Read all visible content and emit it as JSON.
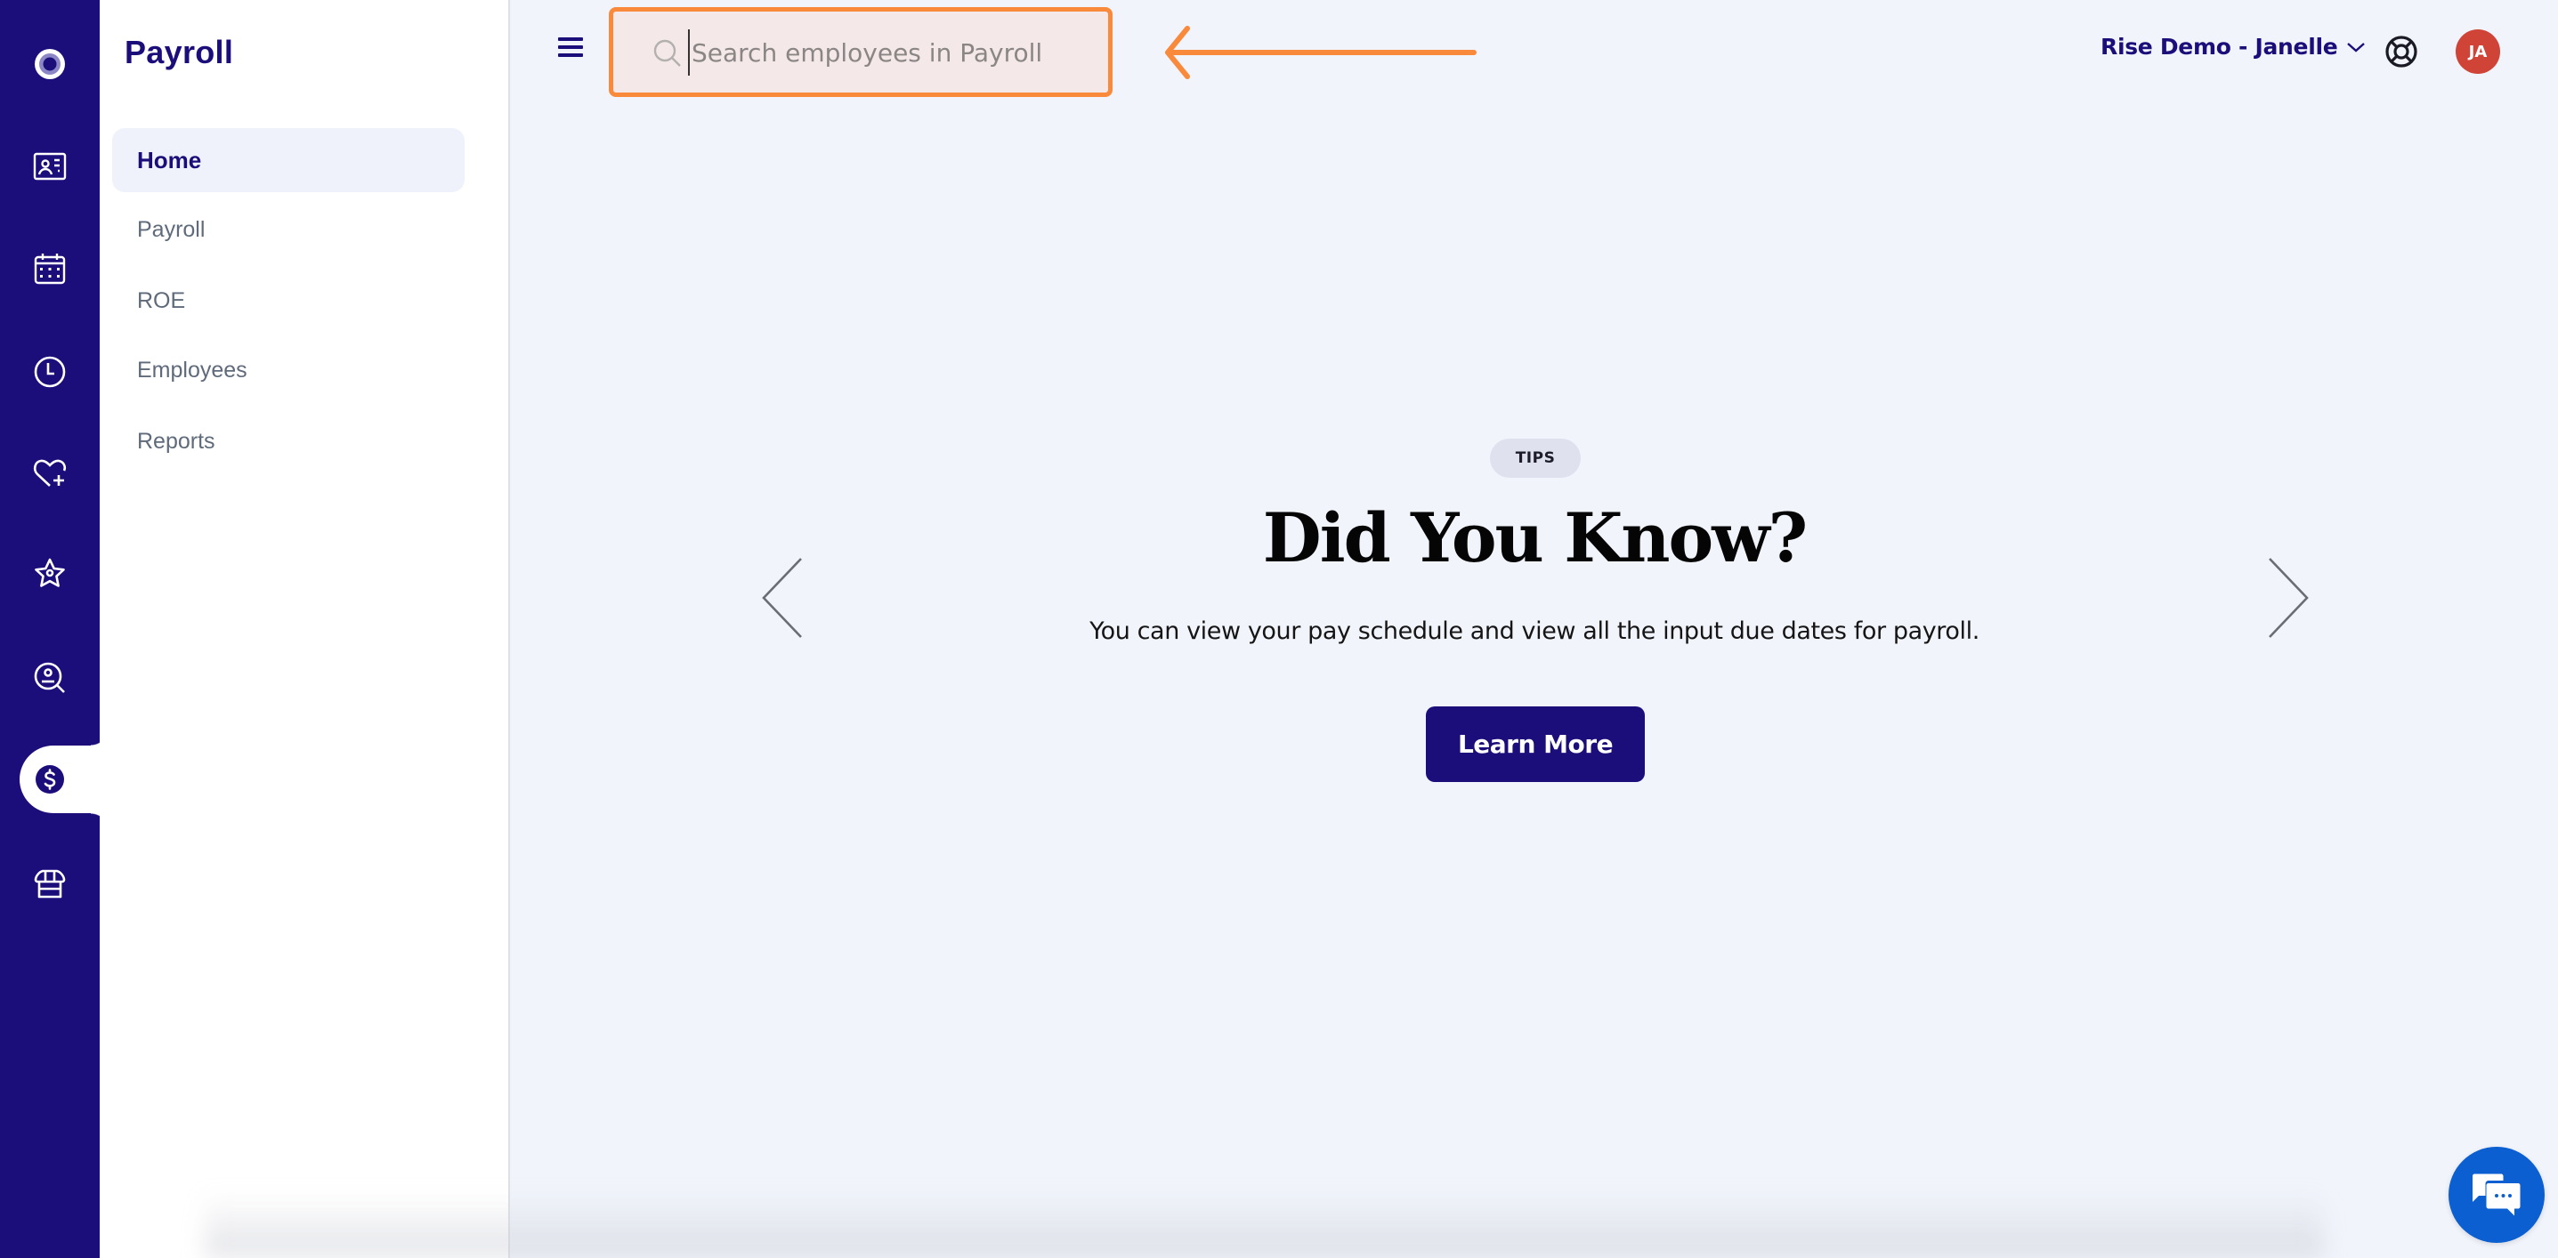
{
  "colors": {
    "brand": "#1c0e7a",
    "background": "#f1f4fb",
    "annotation": "#f98a3c",
    "avatar": "#cf4437",
    "chat": "#0b5fd0"
  },
  "rail": {
    "items": [
      {
        "icon": "logo-icon",
        "label": "Home"
      },
      {
        "icon": "id-card-icon",
        "label": "Directory"
      },
      {
        "icon": "calendar-icon",
        "label": "Calendar"
      },
      {
        "icon": "clock-icon",
        "label": "Time"
      },
      {
        "icon": "heart-plus-icon",
        "label": "Benefits"
      },
      {
        "icon": "star-icon",
        "label": "Performance"
      },
      {
        "icon": "person-search-icon",
        "label": "Recruiting"
      },
      {
        "icon": "dollar-icon",
        "label": "Payroll",
        "active": true
      },
      {
        "icon": "store-icon",
        "label": "Marketplace"
      }
    ]
  },
  "panel": {
    "title": "Payroll",
    "menu": [
      {
        "label": "Home",
        "active": true
      },
      {
        "label": "Payroll"
      },
      {
        "label": "ROE"
      },
      {
        "label": "Employees"
      },
      {
        "label": "Reports"
      }
    ]
  },
  "header": {
    "search_placeholder": "Search employees in Payroll",
    "search_value": "",
    "account_label": "Rise Demo - Janelle",
    "avatar_initials": "JA"
  },
  "tip": {
    "badge": "TIPS",
    "heading": "Did You Know?",
    "body": "You can view your pay schedule and view all the input due dates for payroll.",
    "button_label": "Learn More"
  }
}
